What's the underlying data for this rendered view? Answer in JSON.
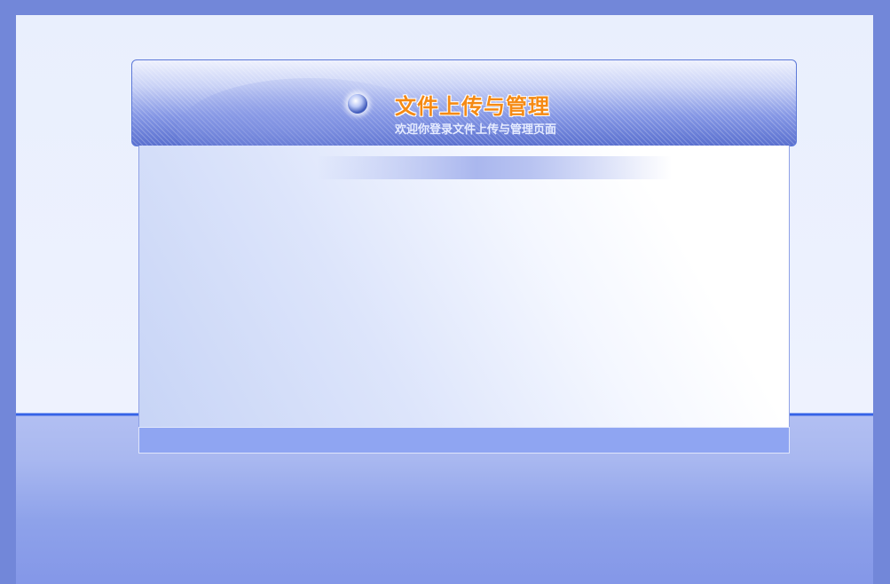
{
  "header": {
    "title": "文件上传与管理",
    "subtitle": "欢迎你登录文件上传与管理页面"
  },
  "icons": {
    "orb": "globe-orb-icon"
  },
  "colors": {
    "background": "#7287d9",
    "title": "#f58a14",
    "subtitle": "#e6ecff",
    "panel_border": "#5c78d8",
    "footer": "#8fa5f2"
  }
}
